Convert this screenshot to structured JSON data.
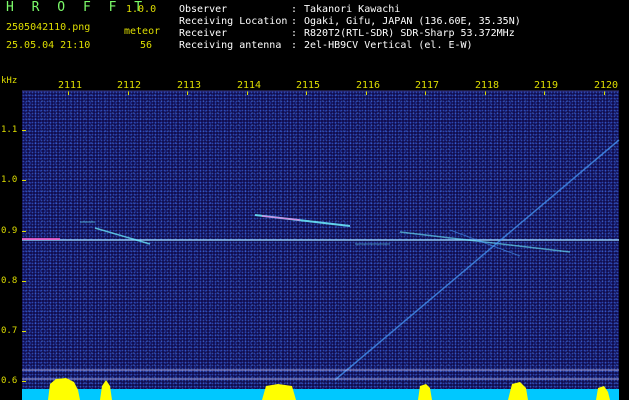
{
  "app": {
    "title": "H R O F F T",
    "version": "1.0.0"
  },
  "file": {
    "name": "2505042110.png",
    "datetime": "25.05.04 21:10"
  },
  "meteor": {
    "label": "meteor",
    "count": "56"
  },
  "info": [
    {
      "label": "Observer",
      "sep": ":",
      "value": "Takanori Kawachi"
    },
    {
      "label": "Receiving Location",
      "sep": ":",
      "value": "Ogaki, Gifu, JAPAN (136.60E, 35.35N)"
    },
    {
      "label": "Receiver",
      "sep": ":",
      "value": "R820T2(RTL-SDR) SDR-Sharp 53.372MHz"
    },
    {
      "label": "Receiving antenna",
      "sep": ":",
      "value": "2el-HB9CV Vertical (el. E-W)"
    }
  ],
  "axis": {
    "y_unit": "kHz",
    "y_ticks": [
      "1.1",
      "1.0",
      "0.9",
      "0.8",
      "0.7",
      "0.6"
    ],
    "x_ticks": [
      "2111",
      "2112",
      "2113",
      "2114",
      "2115",
      "2116",
      "2117",
      "2118",
      "2119",
      "2120"
    ]
  },
  "colors": {
    "background": "#000000",
    "spectrogram": "#100b4a",
    "text_yellow": "#dede00",
    "text_green": "#7cfc6a",
    "carrier": "#9ad8ff",
    "level_cyan": "#00c8ff",
    "level_yellow": "#ffff00"
  }
}
